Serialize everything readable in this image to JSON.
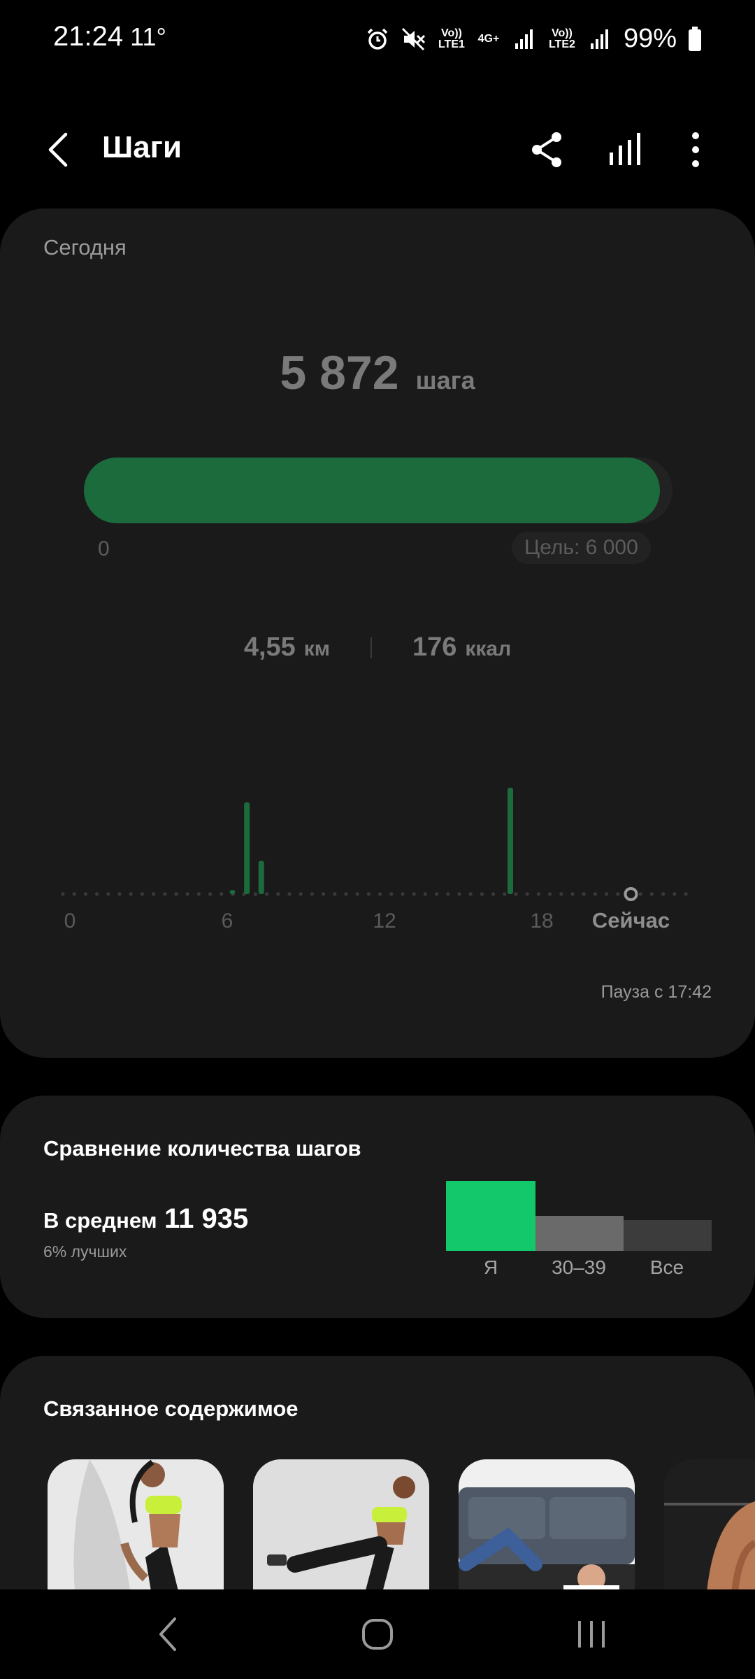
{
  "status_bar": {
    "time": "21:24",
    "temperature": "11°",
    "sim1_label": "Vo)) LTE1",
    "network_label": "4G+",
    "sim2_label": "Vo)) LTE2",
    "battery_percent": "99%",
    "icons": [
      "alarm-icon",
      "mute-icon",
      "signal-icon",
      "battery-icon"
    ]
  },
  "app_bar": {
    "title": "Шаги",
    "icons": [
      "back-icon",
      "share-icon",
      "stats-icon",
      "more-icon"
    ]
  },
  "today_card": {
    "label": "Сегодня",
    "steps_value": "5 872",
    "steps_unit": "шага",
    "progress": {
      "current": 5872,
      "goal": 6000,
      "start_label": "0",
      "goal_label": "Цель: 6 000"
    },
    "distance_value": "4,55",
    "distance_unit": "км",
    "calories_value": "176",
    "calories_unit": "ккал",
    "pause_text": "Пауза с 17:42"
  },
  "chart_data": {
    "type": "bar",
    "x_ticks": [
      "0",
      "6",
      "12",
      "18",
      "Сейчас"
    ],
    "xlim": [
      0,
      24
    ],
    "now_hour": 21.4,
    "bars": [
      {
        "x": 6.2,
        "value": 3
      },
      {
        "x": 6.75,
        "value": 69
      },
      {
        "x": 7.3,
        "value": 25
      },
      {
        "x": 16.8,
        "value": 80
      }
    ],
    "ylim": [
      0,
      100
    ],
    "bar_color": "#1b6b3c"
  },
  "compare_card": {
    "title": "Сравнение количества шагов",
    "avg_label": "В среднем",
    "avg_value": "11 935",
    "percentile_text": "6% лучших",
    "bars": [
      {
        "label": "Я",
        "color": "#13c86b"
      },
      {
        "label": "30–39",
        "color": "#6a6a6a"
      },
      {
        "label": "Все",
        "color": "#3c3c3c"
      }
    ]
  },
  "related_card": {
    "title": "Связанное содержимое"
  },
  "nav_bar": {
    "icons": [
      "nav-back-icon",
      "nav-home-icon",
      "nav-recents-icon"
    ]
  }
}
